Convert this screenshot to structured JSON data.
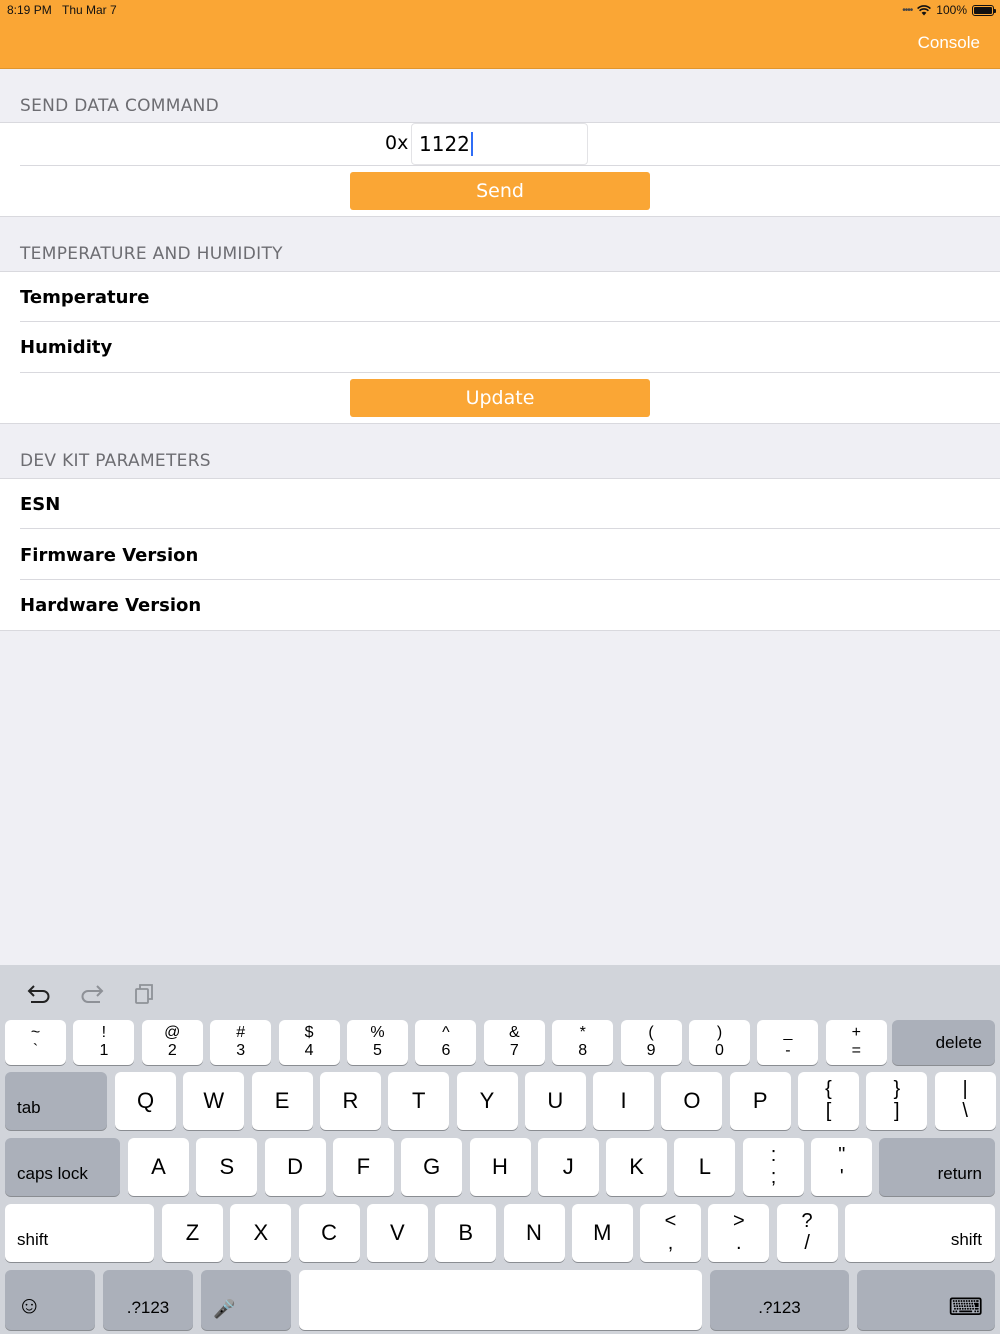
{
  "status_bar": {
    "time": "8:19 PM",
    "date": "Thu Mar 7",
    "battery": "100%"
  },
  "nav": {
    "console_label": "Console"
  },
  "send_section": {
    "header": "SEND DATA COMMAND",
    "prefix": "0x",
    "input_value": "1122",
    "send_label": "Send"
  },
  "temp_section": {
    "header": "TEMPERATURE AND HUMIDITY",
    "rows": [
      "Temperature",
      "Humidity"
    ],
    "update_label": "Update"
  },
  "devkit_section": {
    "header": "DEV KIT PARAMETERS",
    "rows": [
      "ESN",
      "Firmware Version",
      "Hardware Version"
    ]
  },
  "keyboard": {
    "number_row": [
      {
        "top": "~",
        "bot": "`"
      },
      {
        "top": "!",
        "bot": "1"
      },
      {
        "top": "@",
        "bot": "2"
      },
      {
        "top": "#",
        "bot": "3"
      },
      {
        "top": "$",
        "bot": "4"
      },
      {
        "top": "%",
        "bot": "5"
      },
      {
        "top": "^",
        "bot": "6"
      },
      {
        "top": "&",
        "bot": "7"
      },
      {
        "top": "*",
        "bot": "8"
      },
      {
        "top": "(",
        "bot": "9"
      },
      {
        "top": ")",
        "bot": "0"
      },
      {
        "top": "_",
        "bot": "-"
      },
      {
        "top": "+",
        "bot": "="
      }
    ],
    "delete_label": "delete",
    "tab_label": "tab",
    "qwerty_row": [
      "Q",
      "W",
      "E",
      "R",
      "T",
      "Y",
      "U",
      "I",
      "O",
      "P"
    ],
    "qwerty_extra": [
      {
        "top": "{",
        "bot": "["
      },
      {
        "top": "}",
        "bot": "]"
      },
      {
        "top": "|",
        "bot": "\\"
      }
    ],
    "caps_label": "caps lock",
    "home_row": [
      "A",
      "S",
      "D",
      "F",
      "G",
      "H",
      "J",
      "K",
      "L"
    ],
    "home_extra": [
      {
        "top": ":",
        "bot": ";"
      },
      {
        "top": "\"",
        "bot": "'"
      }
    ],
    "return_label": "return",
    "shift_label": "shift",
    "bottom_row": [
      "Z",
      "X",
      "C",
      "V",
      "B",
      "N",
      "M"
    ],
    "bottom_extra": [
      {
        "top": "<",
        "bot": ","
      },
      {
        "top": ">",
        "bot": "."
      },
      {
        "top": "?",
        "bot": "/"
      }
    ],
    "numbers_label": ".?123",
    "emoji_glyph": "☺",
    "mic_glyph": "🎤",
    "keyboard_glyph": "⌨"
  }
}
